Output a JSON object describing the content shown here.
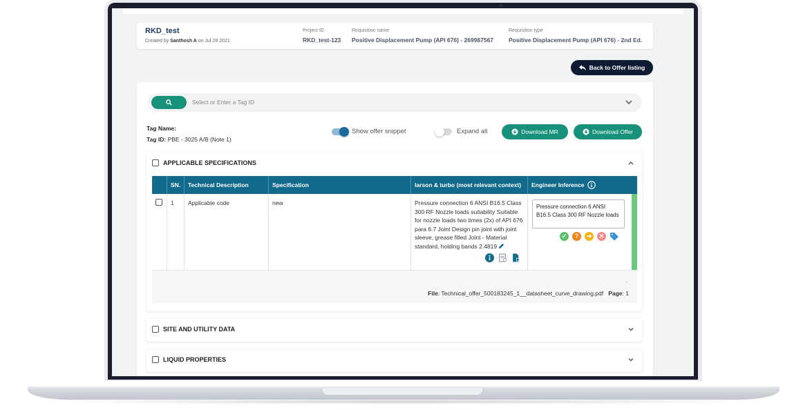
{
  "header": {
    "project_title": "RKD_test",
    "created_prefix": "Created by",
    "created_by": "Santhosh A",
    "created_suffix": "on Jul 28 2021",
    "project_id_label": "Project ID",
    "project_id_value": "RKD_test-123",
    "requisition_name_label": "Requisition name",
    "requisition_name_value": "Positive Displacement Pump (API 676) - 269987567",
    "requisition_type_label": "Requisition type",
    "requisition_type_value": "Positive Displacement Pump (API 676) - 2nd Ed."
  },
  "back_button": {
    "label": "Back to Offer listing",
    "icon": "reply-arrow-icon"
  },
  "search": {
    "placeholder": "Select or Enter a Tag ID",
    "icon": "search-icon"
  },
  "tag": {
    "name_label": "Tag Name:",
    "id_label": "Tag ID:",
    "id_value": "PBE - 3025 A/B (Note 1)"
  },
  "toggles": {
    "show_offer_snippet": {
      "label": "Show offer snippet",
      "on": true
    },
    "expand_all": {
      "label": "Expand all",
      "on": false
    }
  },
  "buttons": {
    "download_mr": "Download MR",
    "download_offer": "Download Offer"
  },
  "sections": [
    {
      "title": "APPLICABLE SPECIFICATIONS",
      "expanded": true
    },
    {
      "title": "SITE AND UTILITY DATA",
      "expanded": false
    },
    {
      "title": "LIQUID PROPERTIES",
      "expanded": false
    }
  ],
  "table": {
    "columns": [
      "SN.",
      "Technical Description",
      "Specification",
      "larson & turbo (most relevant context)",
      "Engineer Inference"
    ],
    "rows": [
      {
        "sn": "1",
        "description": "Applicable code",
        "specification": "new",
        "context": "Pressure connection 6 ANSI B16.5 Class 300 RF Nozzle loads suitability Suitable for nozzle loads two times (2x) of API 676 para 6.7 Joint Design pin joint with joint sleeve, grease filled Joint - Material standard, holding bands 2.4819",
        "inference": "Pressure connection 6 ANSI B16.5 Class 300 RF Nozzle loads"
      }
    ],
    "footer": {
      "dot": ".",
      "file_label": "File",
      "file_value": ": Technical_offer_500183245_1__datasheet_curve_drawing.pdf",
      "page_label": "Page",
      "page_value": ": 1"
    }
  },
  "colors": {
    "primary_green": "#18917a",
    "header_blue": "#136b8c",
    "dark_navy": "#0f1a33",
    "accept_green": "#5cbf6e",
    "question_orange": "#f0851e",
    "forward_orange": "#f5b21b",
    "reject_red": "#f48b8b",
    "tag_blue": "#3b8fd6"
  }
}
